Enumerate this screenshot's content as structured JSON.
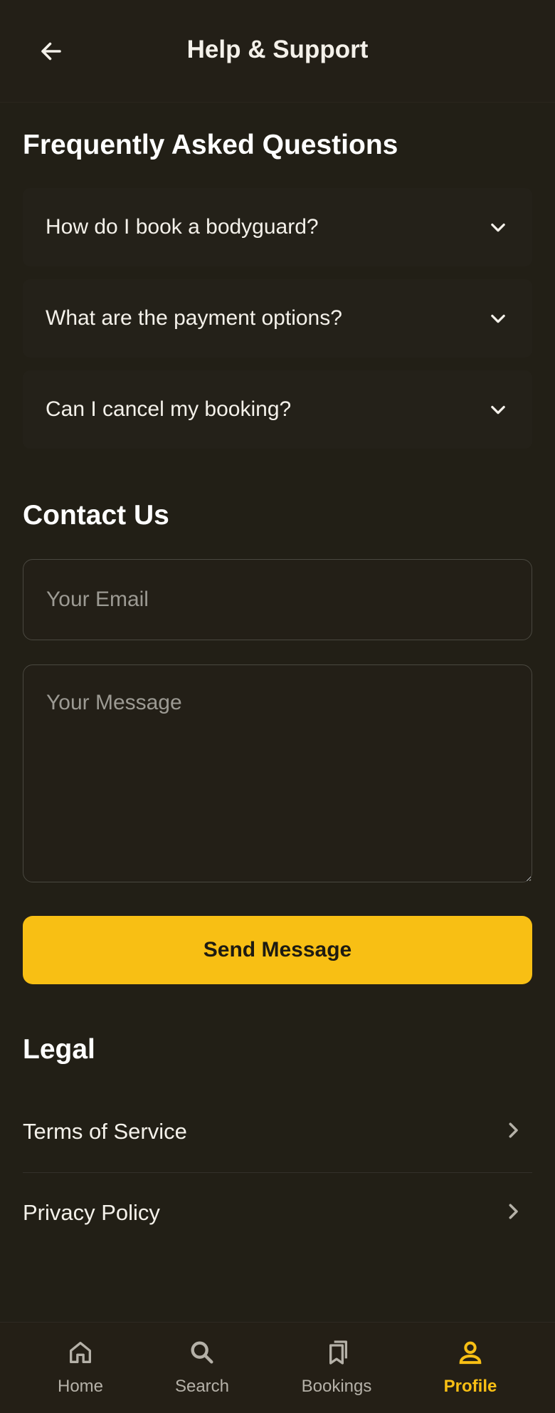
{
  "header": {
    "title": "Help & Support"
  },
  "faq": {
    "title": "Frequently Asked Questions",
    "items": [
      {
        "question": "How do I book a bodyguard?"
      },
      {
        "question": "What are the payment options?"
      },
      {
        "question": "Can I cancel my booking?"
      }
    ]
  },
  "contact": {
    "title": "Contact Us",
    "email_placeholder": "Your Email",
    "message_placeholder": "Your Message",
    "send_label": "Send Message"
  },
  "legal": {
    "title": "Legal",
    "items": [
      {
        "label": "Terms of Service"
      },
      {
        "label": "Privacy Policy"
      }
    ]
  },
  "nav": {
    "items": [
      {
        "label": "Home",
        "icon": "home-icon"
      },
      {
        "label": "Search",
        "icon": "search-icon"
      },
      {
        "label": "Bookings",
        "icon": "bookmarks-icon"
      },
      {
        "label": "Profile",
        "icon": "profile-icon",
        "active": true
      }
    ]
  },
  "colors": {
    "background": "#221f16",
    "accent": "#f8bf14",
    "text": "#f4f1ea",
    "muted": "#9c9a93"
  }
}
